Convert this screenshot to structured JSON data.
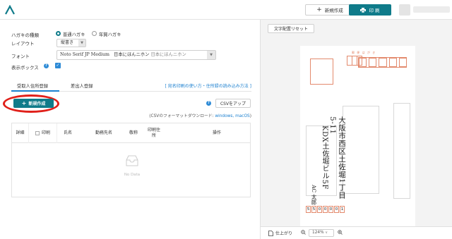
{
  "header": {
    "new_label": "新規作成",
    "print_label": "印 刷",
    "colors": {
      "accent": "#0f7b8a"
    }
  },
  "settings": {
    "type_label": "ハガキの種類",
    "type_options": [
      "普通ハガキ",
      "年賀ハガキ"
    ],
    "layout_label": "レイアウト",
    "layout_value": "縦書き",
    "font_label": "フォント",
    "font_value": "Noto Serif JP Medium",
    "font_sample": "日本にほんニホン",
    "font_sample2": "日本にほんニホン",
    "display_box_label": "表示ボックス"
  },
  "tabs": {
    "items": [
      "受取人住所登録",
      "差出人登録"
    ],
    "link": "[ 宛名印刷の使い方・住所録の読み込み方法 ]"
  },
  "actions": {
    "new_button": "新規作成",
    "csv_button": "CSVをアップ",
    "csv_note_prefix": "(CSVのフォーマットダウンロード: ",
    "csv_note_links": "windows, macOS",
    "csv_note_suffix": ")"
  },
  "table": {
    "columns": [
      "詳細",
      "印刷",
      "氏名",
      "勤務先名",
      "敬称",
      "印刷住所",
      "操作"
    ],
    "empty_text": "No Data"
  },
  "preview": {
    "reset_button": "文字配置リセット",
    "postcard_header": "郵 便 は が き",
    "address_line1": "大阪市西区土佐堀1丁目5-11",
    "address_line2": "KDX土佐堀ビル5F",
    "name": "AC 太郎",
    "zip_digits": [
      "5",
      "5",
      "0",
      "0",
      "0",
      "0",
      "1"
    ],
    "footer_finish": "仕上がり",
    "zoom": "124%"
  }
}
